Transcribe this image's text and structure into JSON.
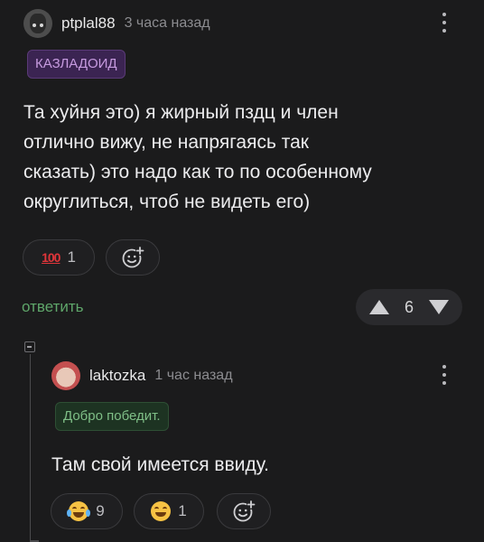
{
  "comment": {
    "username": "ptplal88",
    "time": "3 часа назад",
    "badge": "КАЗЛАДОИД",
    "text_lines": [
      "Та хуйня это) я жирный пздц и член",
      "отлично вижу, не напрягаясь так",
      "сказать) это надо как то по особенному",
      "округлиться, чтоб не видеть его)"
    ],
    "reactions": [
      {
        "icon": "hundred-points-icon",
        "glyph": "100",
        "count": "1"
      }
    ],
    "reply_label": "ответить",
    "score": "6"
  },
  "reply": {
    "username": "laktozka",
    "time": "1 час назад",
    "badge": "Добро победит.",
    "text": "Там свой имеется ввиду.",
    "reactions": [
      {
        "icon": "crying-laughing-face-icon",
        "count": "9"
      },
      {
        "icon": "grinning-sweat-face-icon",
        "count": "1"
      }
    ]
  },
  "colors": {
    "background": "#1b1b1c",
    "accent_green": "#5fa66a",
    "badge_purple": "#3b2452",
    "badge_green": "#1d3322"
  }
}
